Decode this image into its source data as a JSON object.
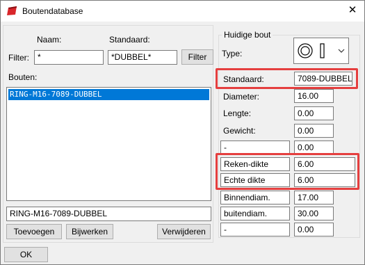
{
  "window": {
    "title": "Boutendatabase",
    "close_glyph": "✕"
  },
  "filter": {
    "name_header": "Naam:",
    "standard_header": "Standaard:",
    "label": "Filter:",
    "name_value": "*",
    "standard_value": "*DUBBEL*",
    "button_label": "Filter"
  },
  "bolts": {
    "label": "Bouten:",
    "items": [
      "RING-M16-7089-DUBBEL"
    ],
    "selected_index": 0,
    "name_value": "RING-M16-7089-DUBBEL"
  },
  "actions": {
    "add": "Toevoegen",
    "update": "Bijwerken",
    "delete": "Verwijderen",
    "ok": "OK"
  },
  "current_bolt": {
    "group_title": "Huidige bout",
    "type_label": "Type:",
    "properties": [
      {
        "label": "Standaard:",
        "value": "7089-DUBBEL",
        "editable_label": false
      },
      {
        "label": "Diameter:",
        "value": "16.00",
        "editable_label": false
      },
      {
        "label": "Lengte:",
        "value": "0.00",
        "editable_label": false
      },
      {
        "label": "Gewicht:",
        "value": "0.00",
        "editable_label": false
      },
      {
        "label": "-",
        "value": "0.00",
        "editable_label": true
      },
      {
        "label": "Reken-dikte",
        "value": "6.00",
        "editable_label": true
      },
      {
        "label": "Echte dikte",
        "value": "6.00",
        "editable_label": true
      },
      {
        "label": "Binnendiam.",
        "value": "17.00",
        "editable_label": true
      },
      {
        "label": "buitendiam.",
        "value": "30.00",
        "editable_label": true
      },
      {
        "label": "-",
        "value": "0.00",
        "editable_label": true
      }
    ]
  },
  "colors": {
    "selection": "#0078d7",
    "highlight": "#e53f3f",
    "app_icon": "#d9262b"
  }
}
